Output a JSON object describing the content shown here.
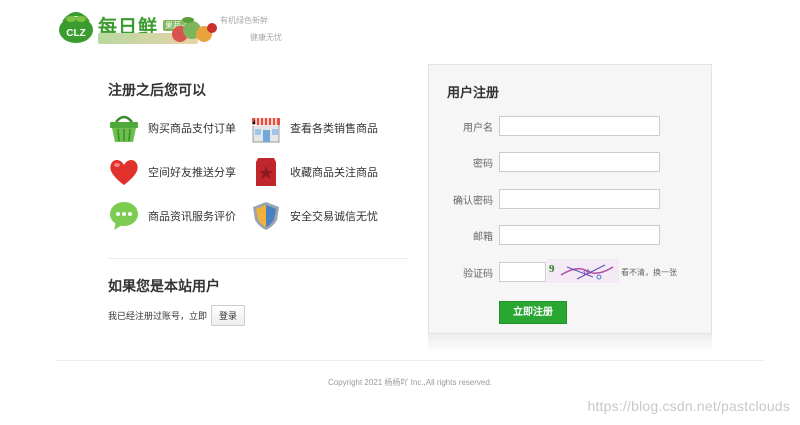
{
  "header": {
    "logo_mark": "CLZ",
    "logo_text": "每日鲜",
    "logo_sub": "果蔬子",
    "slogan_top": "有机绿色新鲜",
    "slogan_bottom": "健康无忧"
  },
  "benefits": {
    "title": "注册之后您可以",
    "items": [
      {
        "label": "购买商品支付订单",
        "icon": "basket-icon"
      },
      {
        "label": "查看各类销售商品",
        "icon": "store-icon"
      },
      {
        "label": "空间好友推送分享",
        "icon": "heart-icon"
      },
      {
        "label": "收藏商品关注商品",
        "icon": "bookmark-icon"
      },
      {
        "label": "商品资讯服务评价",
        "icon": "chat-bubble-icon"
      },
      {
        "label": "安全交易诚信无忧",
        "icon": "shield-icon"
      }
    ]
  },
  "existing_user": {
    "title": "如果您是本站用户",
    "prompt": "我已经注册过账号，立即",
    "login_label": "登录"
  },
  "register_form": {
    "title": "用户注册",
    "fields": [
      {
        "label": "用户名",
        "value": ""
      },
      {
        "label": "密码",
        "value": ""
      },
      {
        "label": "确认密码",
        "value": ""
      },
      {
        "label": "邮箱",
        "value": ""
      },
      {
        "label": "验证码",
        "value": ""
      }
    ],
    "captcha_refresh": "看不清，换一张",
    "submit_label": "立即注册"
  },
  "footer": {
    "copyright": "Copyright 2021 杨杨吖 Inc.,All rights reserved."
  },
  "watermark": "https://blog.csdn.net/pastclouds",
  "colors": {
    "brand_green": "#3a9b2f",
    "button_green": "#2aa633",
    "panel_bg": "#f6f6f6"
  }
}
